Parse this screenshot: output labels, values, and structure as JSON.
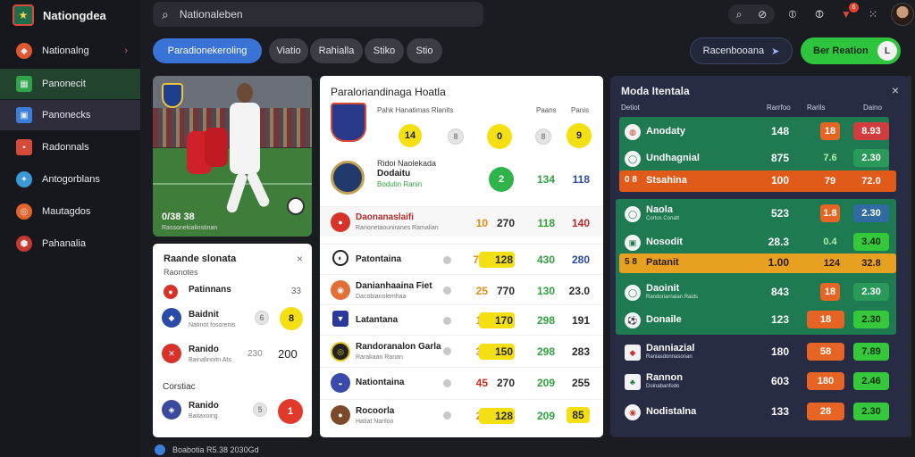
{
  "brand": {
    "name": "Nationgdea",
    "logo_icon": "crest-logo"
  },
  "sidebar": {
    "items": [
      {
        "label": "Nationalng",
        "icon": "shield-icon",
        "color": "#e0572f",
        "chevron": "›"
      },
      {
        "label": "Panonecit",
        "icon": "calendar-icon",
        "color": "#2fa54a"
      },
      {
        "label": "Panonecks",
        "icon": "grid-icon",
        "color": "#3a7fd8"
      },
      {
        "label": "Radonnals",
        "icon": "flag-icon",
        "color": "#d64a3a"
      },
      {
        "label": "Antogorblans",
        "icon": "star-icon",
        "color": "#3a9ad8"
      },
      {
        "label": "Mautagdos",
        "icon": "ring-icon",
        "color": "#e2642a"
      },
      {
        "label": "Pahanalia",
        "icon": "badge-icon",
        "color": "#c7382f"
      }
    ]
  },
  "search": {
    "value": "Nationaleben",
    "icon": "search-icon"
  },
  "topbar": {
    "notif_count": "6"
  },
  "filters": [
    {
      "label": "Paradionekeroling"
    },
    {
      "label": "Viatio"
    },
    {
      "label": "Rahialla"
    },
    {
      "label": "Stiko"
    },
    {
      "label": "Stio"
    }
  ],
  "actions": {
    "secondary": "Racenbooana",
    "primary": "Ber Reation",
    "knob": "L"
  },
  "hero": {
    "caption": "0/38 38",
    "subtitle": "Rassonekialinstinan"
  },
  "left_card": {
    "title": "Raande slonata",
    "subtitle": "Raonotes",
    "close": "×",
    "rows": [
      {
        "name": "Patinnans",
        "meta": "",
        "score": "33"
      },
      {
        "name": "Baidnit",
        "meta": "Natinot fosorenis",
        "odd": "6",
        "pick": "8"
      },
      {
        "name": "Ranido",
        "meta": "Bainalinoitn Ats",
        "odd": "230",
        "pick": "200"
      }
    ],
    "section": "Corstiac",
    "last": {
      "name": "Ranido",
      "meta": "Baitaxoing",
      "odd": "5",
      "pick": "1"
    }
  },
  "mid_card": {
    "title": "Paraloriandinaga Hoatla",
    "header_left": "Pahk Hanatimas Rlanits",
    "header_right": [
      "Paans",
      "Panis"
    ],
    "top": [
      {
        "c1": "14",
        "c2": "8",
        "c3": "0",
        "c4": "8",
        "c5": "9"
      },
      {
        "name": "Ridoi Naolekada",
        "sub1": "Dodaitu",
        "sub2": "Bodutin Ranin",
        "c1": "2",
        "c2": "134",
        "c3": "118"
      }
    ],
    "rows": [
      {
        "name": "Daonanaslaifi",
        "meta": "Ranonetaouniranes Ramalian",
        "a": "10",
        "b": "270",
        "c": "118",
        "d": "140"
      },
      {
        "name": "Patontaina",
        "meta": "",
        "a": "7.4",
        "b": "128",
        "c": "430",
        "d": "280"
      },
      {
        "name": "Danianhaaina Fiet",
        "meta": "Dacobianolemhaa",
        "a": "25",
        "b": "770",
        "c": "130",
        "d": "23.0"
      },
      {
        "name": "Latantana",
        "meta": "",
        "a": "15",
        "b": "170",
        "c": "298",
        "d": "191"
      },
      {
        "name": "Randoranalon Garla",
        "meta": "Rarakaan Ranan",
        "a": "33",
        "b": "150",
        "c": "298",
        "d": "283"
      },
      {
        "name": "Nationtaina",
        "meta": "",
        "a": "45",
        "b": "270",
        "c": "209",
        "d": "255"
      },
      {
        "name": "Rocoorla",
        "meta": "Hatiat Nariloo",
        "a": "25",
        "b": "128",
        "c": "209",
        "d": "85"
      }
    ]
  },
  "right_card": {
    "title": "Moda Itentala",
    "close": "×",
    "head": [
      "Detiot",
      "Rarrfoo",
      "Rarils",
      "Daino"
    ],
    "rows": [
      {
        "name": "Anodaty",
        "val": "148",
        "a": "18",
        "b": "8.93",
        "sub": ""
      },
      {
        "name": "Undhagnial",
        "val": "875",
        "a": "7.6",
        "b": "2.30",
        "sub": ""
      },
      {
        "name": "Stsahina",
        "prefix": "0 8",
        "val": "100",
        "a": "79",
        "b": "72.0",
        "sub": ""
      },
      {
        "name": "Naola",
        "val": "523",
        "a": "1.8",
        "b": "2.30",
        "sub": "Cortos Conatt"
      },
      {
        "name": "Nosodit",
        "val": "28.3",
        "a": "0.4",
        "b": "3.40",
        "sub": ""
      },
      {
        "name": "Patanit",
        "prefix": "5 8",
        "val": "1.00",
        "a": "124",
        "b": "32.8",
        "sub": ""
      },
      {
        "name": "Daoinit",
        "val": "843",
        "a": "18",
        "b": "2.30",
        "sub": "Randoriarnalan Raids"
      },
      {
        "name": "Donaile",
        "val": "123",
        "a": "18",
        "b": "2.30",
        "sub": ""
      },
      {
        "name": "Danniazial",
        "val": "180",
        "a": "58",
        "b": "7.89",
        "sub": "Raniasdonnasonan"
      },
      {
        "name": "Rannon",
        "val": "603",
        "a": "180",
        "b": "2.46",
        "sub": "Doinabanfodo"
      },
      {
        "name": "Nodistalna",
        "val": "133",
        "a": "28",
        "b": "2.30",
        "sub": ""
      }
    ]
  },
  "footer": {
    "text": "Boabotia R5.38 2030Gd"
  },
  "colors": {
    "accent": "#3a73d6",
    "cta": "#2fc43e",
    "hot": "#e76524"
  }
}
